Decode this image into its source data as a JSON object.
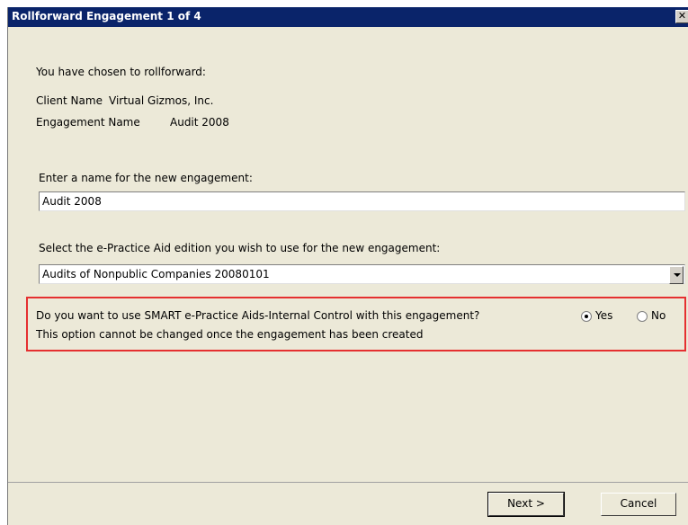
{
  "window": {
    "title": "Rollforward Engagement 1 of 4",
    "close_glyph": "✕"
  },
  "info": {
    "intro": "You have chosen to rollforward:",
    "client_label": "Client Name",
    "client_value": "Virtual Gizmos, Inc.",
    "engagement_label": "Engagement Name",
    "engagement_value": "Audit 2008"
  },
  "name_field": {
    "prompt": "Enter a name for the new engagement:",
    "value": "Audit 2008"
  },
  "edition_field": {
    "prompt": "Select the e-Practice Aid edition you wish to use for the new engagement:",
    "selected": "Audits of Nonpublic Companies 20080101"
  },
  "smart_option": {
    "question": "Do you want to use SMART e-Practice Aids-Internal Control with this engagement?",
    "note": "This option cannot be changed once the engagement has been created",
    "yes_label": "Yes",
    "no_label": "No",
    "selected": "Yes",
    "highlight_color": "#e53030"
  },
  "buttons": {
    "next_label": "Next >",
    "cancel_label": "Cancel"
  }
}
